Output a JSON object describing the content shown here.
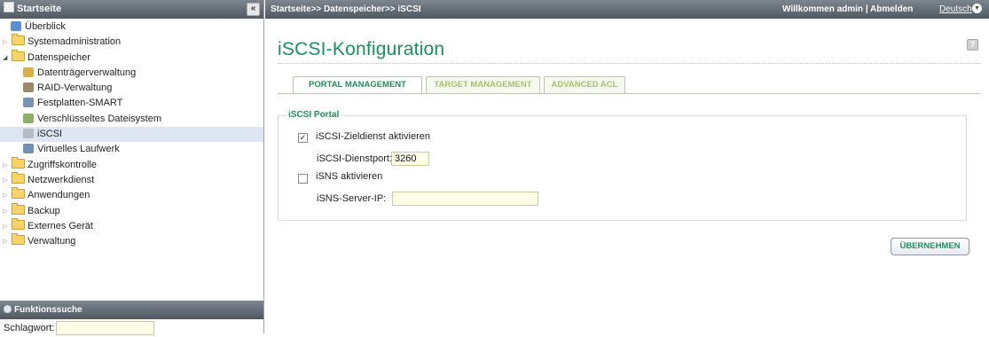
{
  "sidebar": {
    "header_title": "Startseite",
    "collapse_glyph": "«",
    "tree": [
      {
        "label": "Überblick",
        "icon": "overview-icon"
      },
      {
        "label": "Systemadministration",
        "icon": "folder-icon"
      },
      {
        "label": "Datenspeicher",
        "icon": "folder-open-icon"
      },
      {
        "label": "Datenträgerverwaltung",
        "icon": "disk-icon"
      },
      {
        "label": "RAID-Verwaltung",
        "icon": "raid-icon"
      },
      {
        "label": "Festplatten-SMART",
        "icon": "smart-icon"
      },
      {
        "label": "Verschlüsseltes Dateisystem",
        "icon": "encryption-icon"
      },
      {
        "label": "iSCSI",
        "icon": "iscsi-icon"
      },
      {
        "label": "Virtuelles Laufwerk",
        "icon": "virtual-drive-icon"
      },
      {
        "label": "Zugriffskontrolle",
        "icon": "folder-icon"
      },
      {
        "label": "Netzwerkdienst",
        "icon": "folder-icon"
      },
      {
        "label": "Anwendungen",
        "icon": "folder-icon"
      },
      {
        "label": "Backup",
        "icon": "folder-icon"
      },
      {
        "label": "Externes Gerät",
        "icon": "folder-icon"
      },
      {
        "label": "Verwaltung",
        "icon": "folder-icon"
      }
    ],
    "search": {
      "header_title": "Funktionssuche",
      "label": "Schlagwort:",
      "value": ""
    }
  },
  "topbar": {
    "breadcrumb": "Startseite>> Datenspeicher>> iSCSI",
    "welcome": "Willkommen admin | Abmelden",
    "language": "Deutsch"
  },
  "main": {
    "title": "iSCSI-Konfiguration",
    "tabs": [
      {
        "label": "PORTAL MANAGEMENT",
        "active": true
      },
      {
        "label": "TARGET MANAGEMENT",
        "active": false
      },
      {
        "label": "ADVANCED ACL",
        "active": false
      }
    ],
    "portal": {
      "legend": "iSCSI Portal",
      "enable_target_service": {
        "label": "iSCSI-Zieldienst aktivieren",
        "checked": true
      },
      "service_port": {
        "label": "iSCSI-Dienstport:",
        "value": "3260"
      },
      "enable_isns": {
        "label": "iSNS aktivieren",
        "checked": false
      },
      "isns_server_ip": {
        "label": "iSNS-Server-IP:",
        "value": ""
      }
    },
    "apply_label": "ÜBERNEHMEN"
  },
  "colors": {
    "accent_green": "#1a8f5d",
    "header_gray": "#5a636c",
    "selected_row": "#dde6f2",
    "input_bg": "#ffffe6"
  }
}
